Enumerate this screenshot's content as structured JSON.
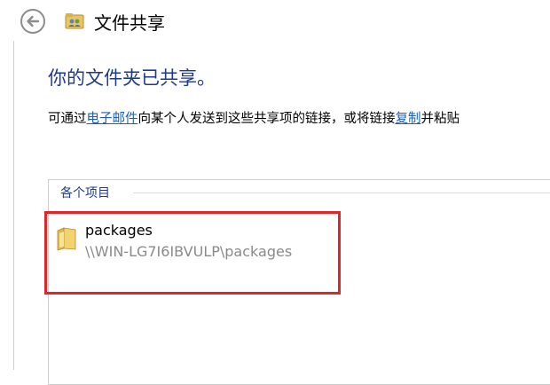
{
  "window": {
    "title": "文件共享",
    "back_icon": "back-arrow-icon",
    "title_icon": "file-share-icon"
  },
  "main": {
    "heading": "你的文件夹已共享。",
    "description": {
      "part1": "可通过",
      "link_email": "电子邮件",
      "part2": "向某个人发送到这些共享项的链接，或将链接",
      "link_copy": "复制",
      "part3": "并粘贴"
    },
    "items_header": "各个项目",
    "items": [
      {
        "name": "packages",
        "path": "\\\\WIN-LG7I6IBVULP\\packages",
        "icon": "folder-icon"
      }
    ]
  },
  "colors": {
    "heading": "#1e3a8a",
    "link": "#1c5fb4",
    "highlight": "#e0262a"
  }
}
